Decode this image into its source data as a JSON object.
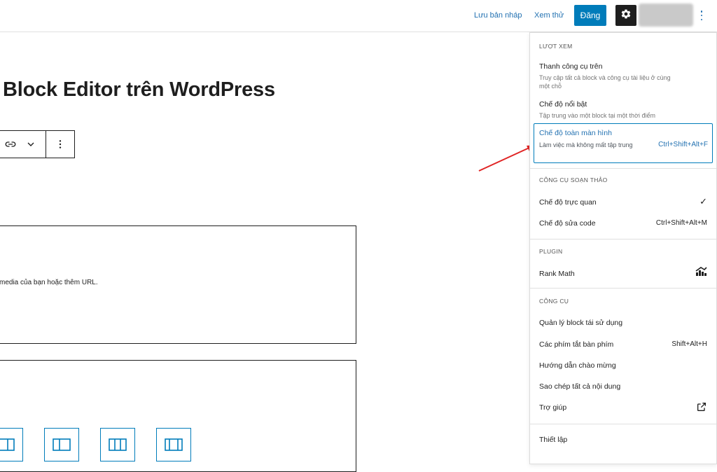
{
  "topbar": {
    "save_draft": "Lưu bản nháp",
    "preview": "Xem thử",
    "publish": "Đăng",
    "settings_icon": "gear-icon",
    "more_icon": "vertical-ellipsis-icon"
  },
  "editor": {
    "post_title": "Block Editor trên WordPress",
    "toolbar_icons": [
      "link-icon",
      "chevron-down-icon",
      "vertical-ellipsis-icon"
    ],
    "media_placeholder_text": "media của bạn hoặc thêm URL.",
    "column_layout_icons": [
      "columns-70-30-icon",
      "columns-30-70-icon",
      "columns-three-equal-icon",
      "columns-three-wide-center-icon"
    ]
  },
  "menu": {
    "view": {
      "title": "LƯỢT XEM",
      "items": [
        {
          "label": "Thanh công cụ trên",
          "desc": "Truy cập tất cả block và công cụ tài liệu ở cùng một chỗ"
        },
        {
          "label": "Chế độ nổi bật",
          "desc": "Tập trung vào một block tại một thời điểm"
        },
        {
          "label": "Chế độ toàn màn hình",
          "desc": "Làm việc mà không mất tập trung",
          "shortcut": "Ctrl+Shift+Alt+F"
        }
      ]
    },
    "editor_tools": {
      "title": "CÔNG CỤ SOẠN THẢO",
      "items": [
        {
          "label": "Chế độ trực quan",
          "check": "✓"
        },
        {
          "label": "Chế độ sửa code",
          "shortcut": "Ctrl+Shift+Alt+M"
        }
      ]
    },
    "plugin": {
      "title": "PLUGIN",
      "items": [
        {
          "label": "Rank Math",
          "icon": "rank-math-icon"
        }
      ]
    },
    "tools": {
      "title": "CÔNG CỤ",
      "items": [
        {
          "label": "Quản lý block tái sử dụng"
        },
        {
          "label": "Các phím tắt bàn phím",
          "shortcut": "Shift+Alt+H"
        },
        {
          "label": "Hướng dẫn chào mừng"
        },
        {
          "label": "Sao chép tất cả nội dung"
        },
        {
          "label": "Trợ giúp",
          "icon": "external-link-icon"
        }
      ]
    },
    "settings": {
      "label": "Thiết lập"
    }
  },
  "colors": {
    "accent": "#007cba",
    "link": "#2271b1",
    "annotation_arrow": "#e02424"
  }
}
